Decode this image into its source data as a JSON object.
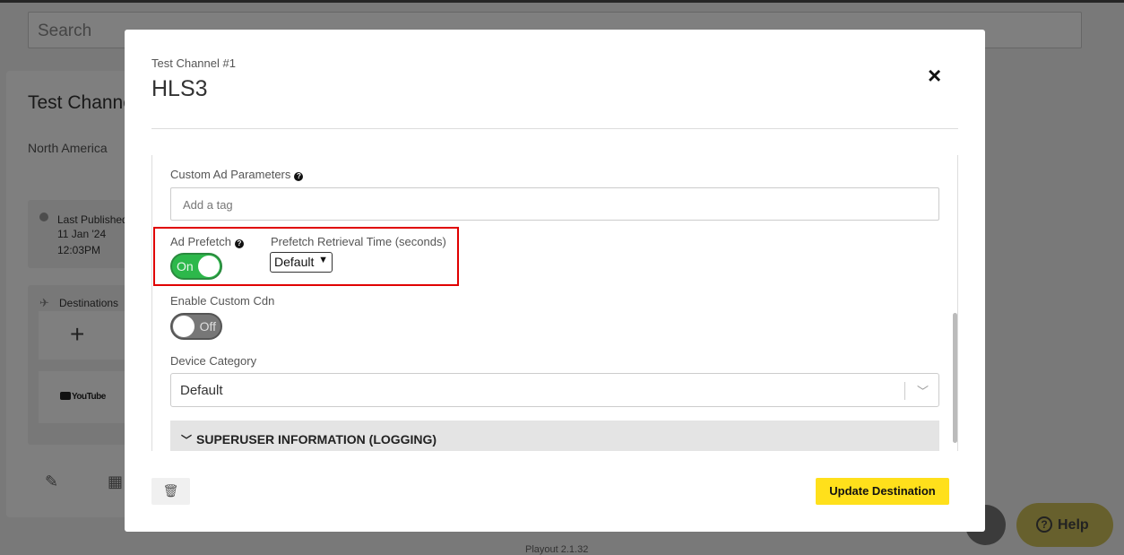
{
  "background": {
    "search_placeholder": "Search",
    "card_title": "Test Channe",
    "region": "North America",
    "last_published_label": "Last Published",
    "last_published_date": "11 Jan '24",
    "last_published_time": "12:03PM",
    "destinations_label": "Destinations",
    "youtube_label": "YouTube",
    "version": "Playout 2.1.32",
    "help_label": "Help"
  },
  "modal": {
    "subtitle": "Test Channel #1",
    "title": "HLS3",
    "close_icon": "×",
    "fields": {
      "custom_ad_params_label": "Custom Ad Parameters",
      "custom_ad_params_placeholder": "Add a tag",
      "ad_prefetch_label": "Ad Prefetch",
      "ad_prefetch_toggle": "On",
      "prefetch_time_label": "Prefetch Retrieval Time (seconds)",
      "prefetch_time_value": "Default",
      "custom_cdn_label": "Enable Custom Cdn",
      "custom_cdn_toggle": "Off",
      "device_category_label": "Device Category",
      "device_category_value": "Default",
      "superuser_section": "SUPERUSER INFORMATION (LOGGING)"
    },
    "footer": {
      "update_button": "Update Destination"
    }
  },
  "colors": {
    "toggle_on": "#2db84b",
    "toggle_off": "#777777",
    "primary_button": "#ffe01b",
    "highlight": "#e00000"
  }
}
